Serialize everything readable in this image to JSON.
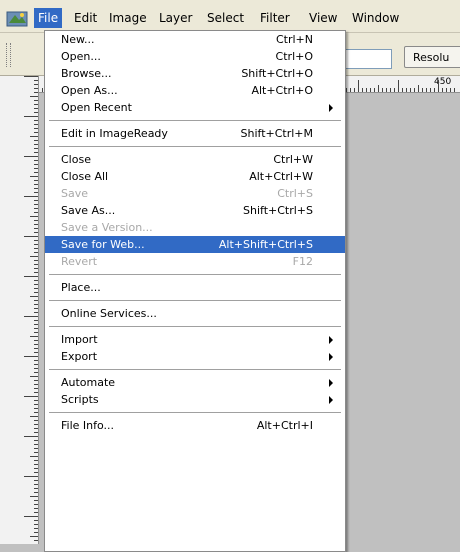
{
  "menubar": {
    "items": [
      "File",
      "Edit",
      "Image",
      "Layer",
      "Select",
      "Filter",
      "View",
      "Window"
    ]
  },
  "options": {
    "button_label": "Resolu"
  },
  "ruler": {
    "top_label": "450"
  },
  "file_menu": {
    "groups": [
      [
        {
          "label": "New...",
          "shortcut": "Ctrl+N"
        },
        {
          "label": "Open...",
          "shortcut": "Ctrl+O"
        },
        {
          "label": "Browse...",
          "shortcut": "Shift+Ctrl+O"
        },
        {
          "label": "Open As...",
          "shortcut": "Alt+Ctrl+O"
        },
        {
          "label": "Open Recent",
          "shortcut": "",
          "submenu": true
        }
      ],
      [
        {
          "label": "Edit in ImageReady",
          "shortcut": "Shift+Ctrl+M"
        }
      ],
      [
        {
          "label": "Close",
          "shortcut": "Ctrl+W"
        },
        {
          "label": "Close All",
          "shortcut": "Alt+Ctrl+W"
        },
        {
          "label": "Save",
          "shortcut": "Ctrl+S",
          "disabled": true
        },
        {
          "label": "Save As...",
          "shortcut": "Shift+Ctrl+S"
        },
        {
          "label": "Save a Version...",
          "shortcut": "",
          "disabled": true
        },
        {
          "label": "Save for Web...",
          "shortcut": "Alt+Shift+Ctrl+S",
          "highlighted": true
        },
        {
          "label": "Revert",
          "shortcut": "F12",
          "disabled": true
        }
      ],
      [
        {
          "label": "Place...",
          "shortcut": ""
        }
      ],
      [
        {
          "label": "Online Services...",
          "shortcut": ""
        }
      ],
      [
        {
          "label": "Import",
          "shortcut": "",
          "submenu": true
        },
        {
          "label": "Export",
          "shortcut": "",
          "submenu": true
        }
      ],
      [
        {
          "label": "Automate",
          "shortcut": "",
          "submenu": true
        },
        {
          "label": "Scripts",
          "shortcut": "",
          "submenu": true
        }
      ],
      [
        {
          "label": "File Info...",
          "shortcut": "Alt+Ctrl+I"
        }
      ]
    ]
  },
  "colors": {
    "highlight": "#316ac5",
    "menubar_bg": "#ece9d8",
    "canvas_bg": "#c0c0c0"
  }
}
